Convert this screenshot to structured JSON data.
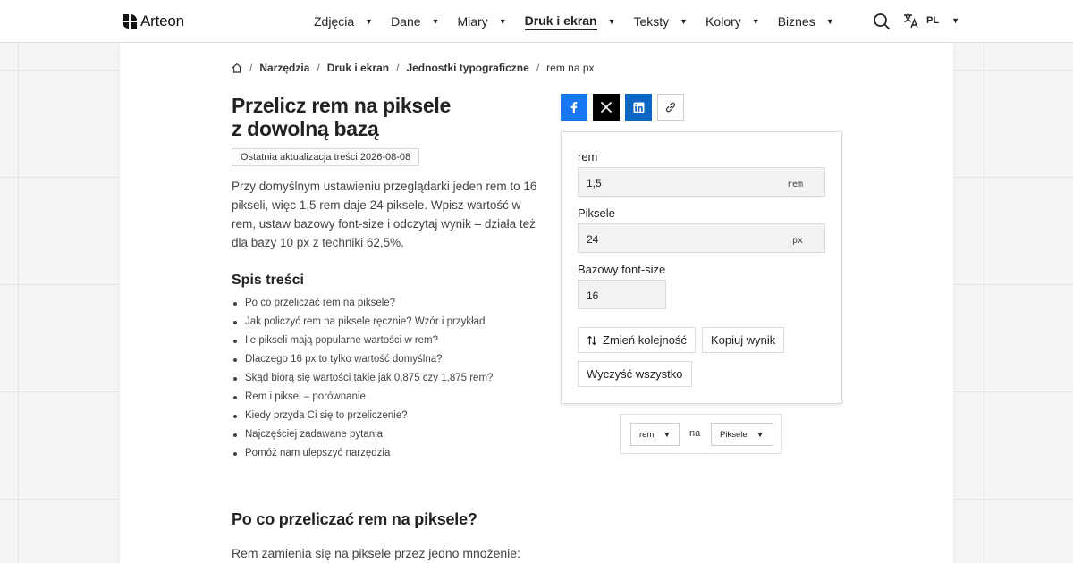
{
  "header": {
    "logo_text": "Arteon",
    "nav": [
      {
        "label": "Zdjęcia"
      },
      {
        "label": "Dane"
      },
      {
        "label": "Miary"
      },
      {
        "label": "Druk i ekran",
        "active": true
      },
      {
        "label": "Teksty"
      },
      {
        "label": "Kolory"
      },
      {
        "label": "Biznes"
      }
    ],
    "language_code": "PL",
    "icons": {
      "search": "search-icon",
      "language": "translate-icon",
      "home": "home-icon"
    }
  },
  "breadcrumb": {
    "items": [
      "Narzędzia",
      "Druk i ekran",
      "Jednostki typograficzne"
    ],
    "current": "rem na px"
  },
  "article": {
    "title_line1": "Przelicz rem na piksele",
    "title_line2": "z dowolną bazą",
    "updated": "Ostatnia aktualizacja treści:2026-08-08",
    "intro": "Przy domyślnym ustawieniu przeglądarki jeden rem to 16 pikseli, więc 1,5 rem daje 24 piksele. Wpisz wartość w rem, ustaw bazowy font-size i odczytaj wynik – działa też dla bazy 10 px z techniki 62,5%.",
    "toc_title": "Spis treści",
    "toc": [
      "Po co przeliczać rem na piksele?",
      "Jak policzyć rem na piksele ręcznie? Wzór i przykład",
      "Ile pikseli mają popularne wartości w rem?",
      "Dlaczego 16 px to tylko wartość domyślna?",
      "Skąd biorą się wartości takie jak 0,875 czy 1,875 rem?",
      "Rem i piksel – porównanie",
      "Kiedy przyda Ci się to przeliczenie?",
      "Najczęściej zadawane pytania",
      "Pomóż nam ulepszyć narzędzia"
    ],
    "section_title": "Po co przeliczać rem na piksele?",
    "section_text": "Rem zamienia się na piksele przez jedno mnożenie:"
  },
  "share": {
    "icons": [
      "facebook-icon",
      "x-icon",
      "linkedin-icon",
      "link-icon"
    ],
    "colors": {
      "facebook": "#1877f2",
      "x": "#000000",
      "linkedin": "#0a66c2"
    }
  },
  "calculator": {
    "rem_label": "rem",
    "rem_value": "1,5",
    "rem_unit": "rem",
    "px_label": "Piksele",
    "px_value": "24",
    "px_unit": "px",
    "base_label": "Bazowy font-size",
    "base_value": "16",
    "swap_label": "Zmień kolejność",
    "copy_label": "Kopiuj wynik",
    "clear_label": "Wyczyść wszystko"
  },
  "converter": {
    "from": "rem",
    "connector": "na",
    "to": "Piksele"
  }
}
